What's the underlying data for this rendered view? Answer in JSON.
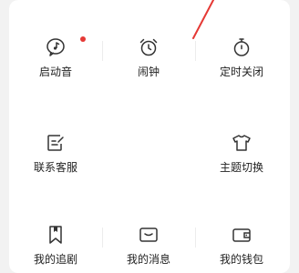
{
  "grid": {
    "row1": [
      {
        "label": "启动音",
        "icon": "music-note-bubble-icon"
      },
      {
        "label": "闹钟",
        "icon": "alarm-clock-icon"
      },
      {
        "label": "定时关闭",
        "icon": "timer-icon"
      }
    ],
    "row2": [
      {
        "label": "联系客服",
        "icon": "feedback-edit-icon"
      },
      {
        "label": "主题切换",
        "icon": "tshirt-icon"
      }
    ],
    "row3": [
      {
        "label": "我的追剧",
        "icon": "bookmark-icon"
      },
      {
        "label": "我的消息",
        "icon": "envelope-icon"
      },
      {
        "label": "我的钱包",
        "icon": "wallet-icon"
      }
    ]
  },
  "colors": {
    "badge": "#e53935",
    "arrow": "#e53935",
    "icon": "#333333"
  }
}
